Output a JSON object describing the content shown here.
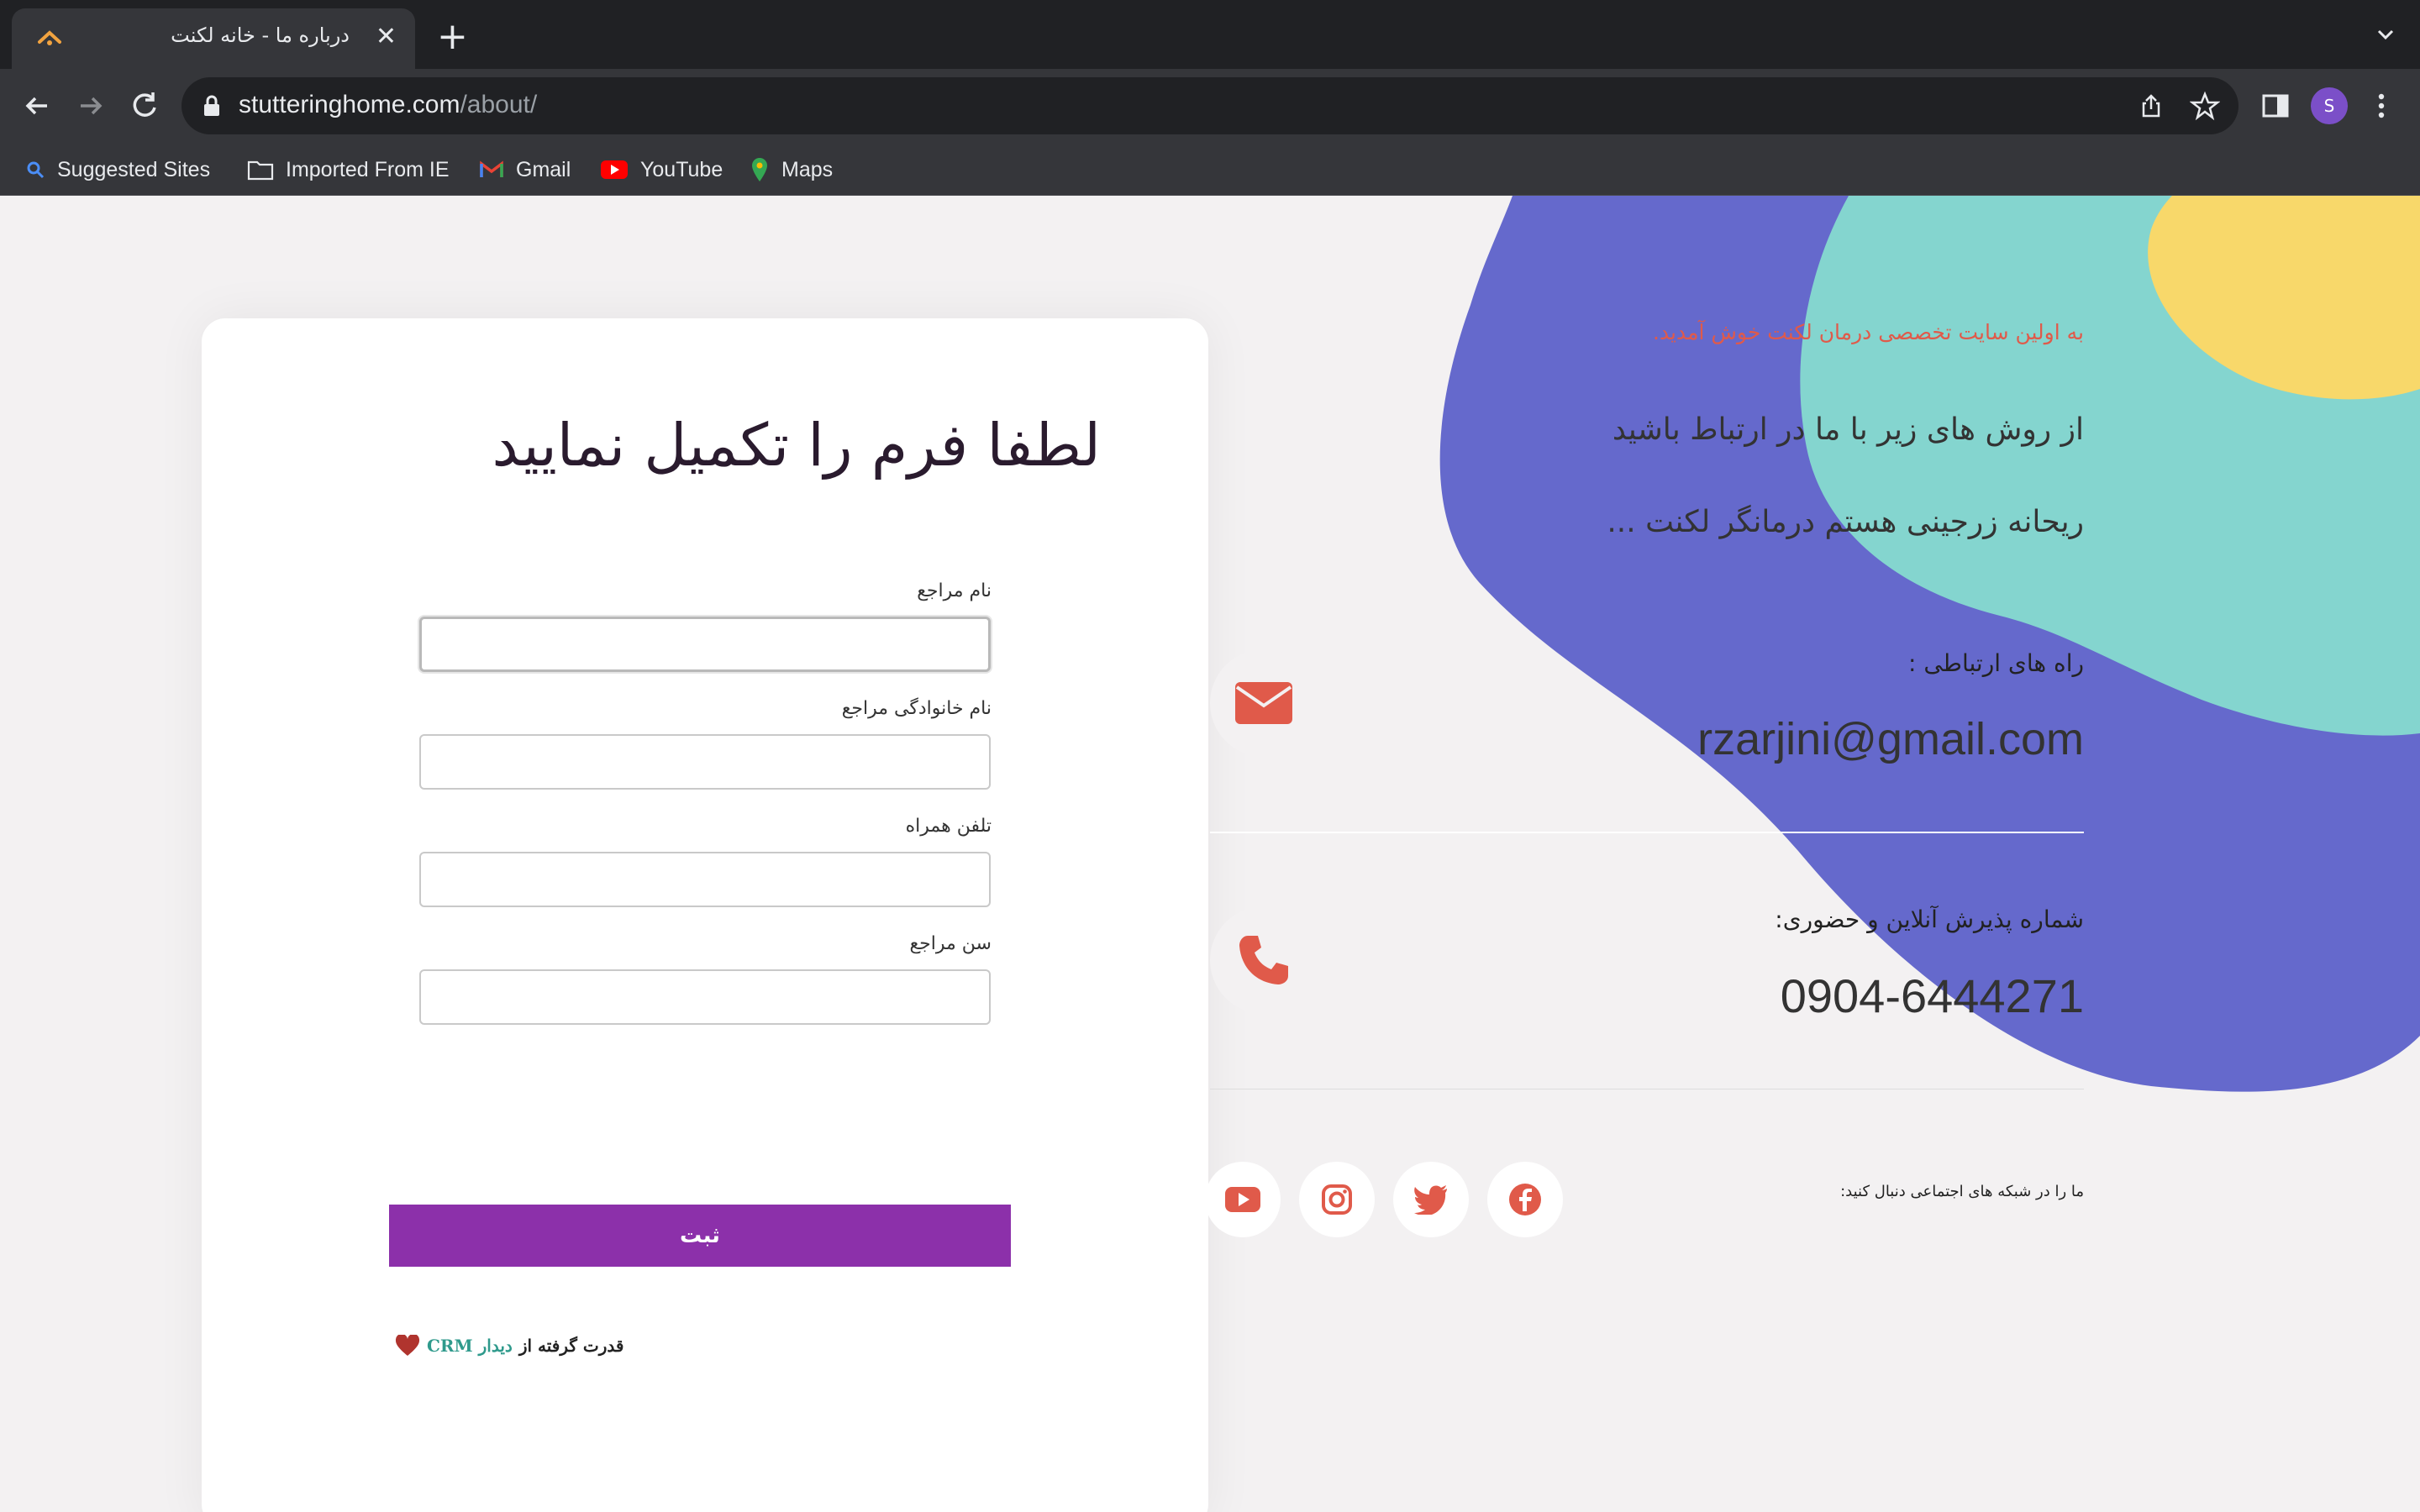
{
  "browser": {
    "tab_title": "درباره ما - خانه لکنت",
    "url_host": "stutteringhome.com",
    "url_path": "/about/",
    "bookmarks": [
      "Suggested Sites",
      "Imported From IE",
      "Gmail",
      "YouTube",
      "Maps"
    ],
    "profile_initial": "S"
  },
  "form": {
    "title": "لطفا فرم را تکمیل نمایید",
    "fields": [
      {
        "label": "نام مراجع",
        "value": ""
      },
      {
        "label": "نام خانوادگی مراجع",
        "value": ""
      },
      {
        "label": "تلفن همراه",
        "value": ""
      },
      {
        "label": "سن مراجع",
        "value": ""
      }
    ],
    "submit_label": "ثبت",
    "powered_prefix": "قدرت گرفته از",
    "powered_brand": "دیدار CRM"
  },
  "info": {
    "welcome": "به اولین سایت تخصصی درمان لکنت خوش آمدید.",
    "line1": "از روش های زیر با ما در ارتباط باشید",
    "line2": "ریحانه زرجینی هستم درمانگر لکنت ...",
    "contact_heading": "راه های ارتباطی :",
    "email": "rzarjini@gmail.com",
    "phone_heading": "شماره پذیرش آنلاین و حضوری:",
    "phone": "0904-6444271",
    "follow_text": "ما را در شبکه های اجتماعی دنبال کنید:"
  },
  "colors": {
    "accent_purple": "#8c30aa",
    "blob_indigo": "#6569cc",
    "blob_teal": "#84d5cf",
    "blob_yellow": "#f8d86a",
    "icon_red": "#e05a4a"
  }
}
